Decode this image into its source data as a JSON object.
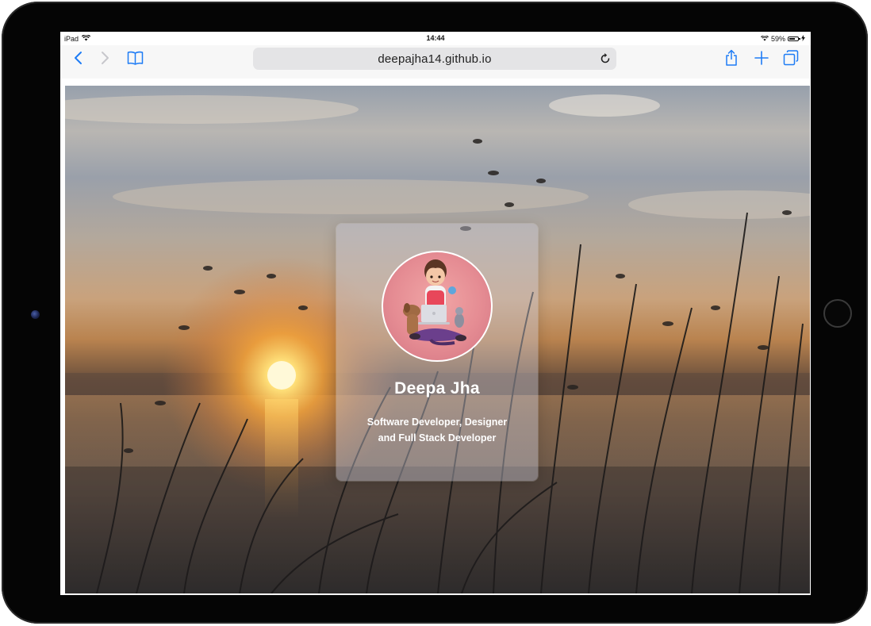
{
  "device": {
    "name": "iPad"
  },
  "status_bar": {
    "carrier": "iPad",
    "time": "14:44",
    "battery_percent": "59%"
  },
  "browser": {
    "url": "deepajha14.github.io",
    "accent_color": "#1e7cf5",
    "back_icon": "chevron-left-icon",
    "forward_icon": "chevron-right-icon",
    "bookmarks_icon": "book-icon",
    "reload_icon": "reload-icon",
    "share_icon": "share-icon",
    "new_tab_icon": "plus-icon",
    "tabs_icon": "tabs-icon"
  },
  "profile": {
    "name": "Deepa Jha",
    "role_line1": "Software Developer, Designer",
    "role_line2": "and Full Stack Developer"
  }
}
